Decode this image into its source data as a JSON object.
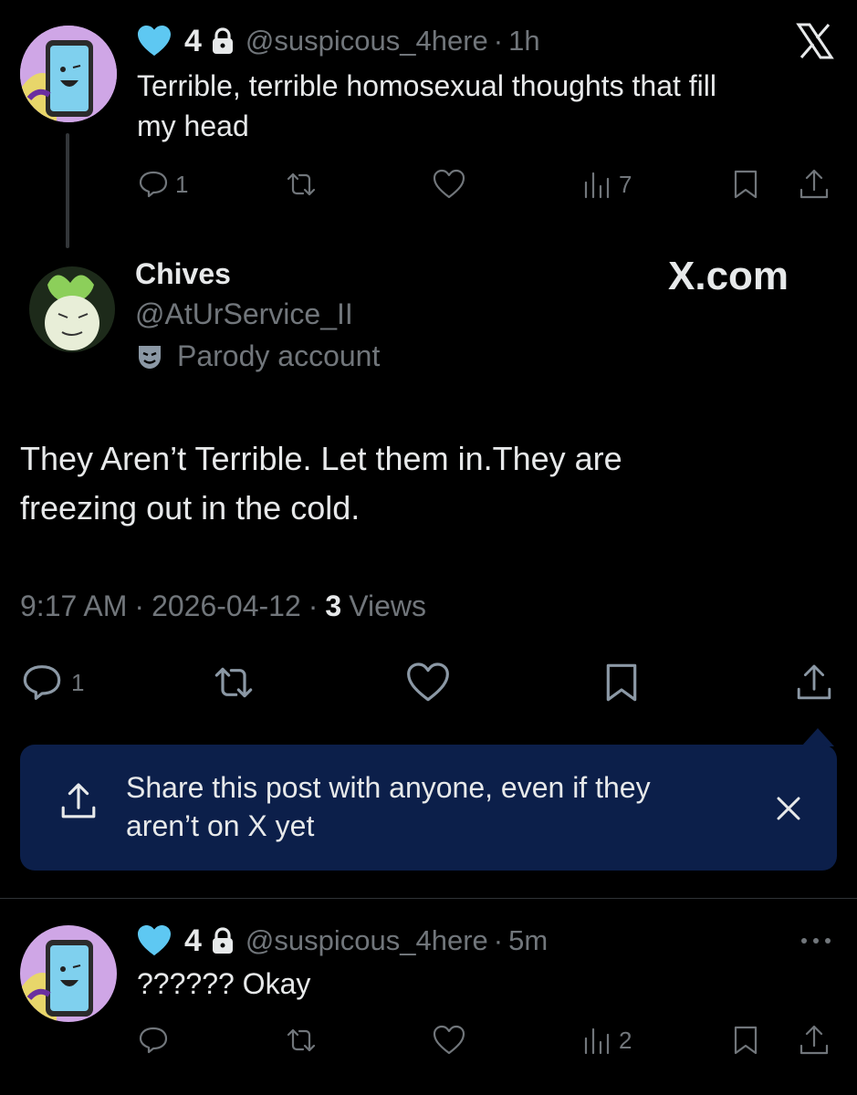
{
  "reply_parent": {
    "display_name": "4",
    "handle": "@suspicous_4here",
    "time": "1h",
    "text_line1": "Terrible, terrible homosexual thoughts that fill",
    "text_line2": "my head",
    "replies": "1",
    "views": "7"
  },
  "main_post": {
    "display_name": "Chives",
    "handle": "@AtUrService_II",
    "label": "Parody account",
    "watermark": "X.com",
    "text_line1": "They Aren’t Terrible. Let them in.They are",
    "text_line2": "freezing out in the cold.",
    "time": "9:17 AM",
    "date": "2026-04-12",
    "views_count": "3",
    "views_label": "Views",
    "replies": "1"
  },
  "share_prompt": {
    "line1": "Share this post with anyone, even if they",
    "line2": "aren’t on X yet",
    "bg_color": "#0c1f4a"
  },
  "reply": {
    "display_name": "4",
    "handle": "@suspicous_4here",
    "time": "5m",
    "text": "?????? Okay",
    "views": "2"
  },
  "colors": {
    "accent_heart": "#5ec8f2",
    "secondary_text": "#71767b"
  }
}
